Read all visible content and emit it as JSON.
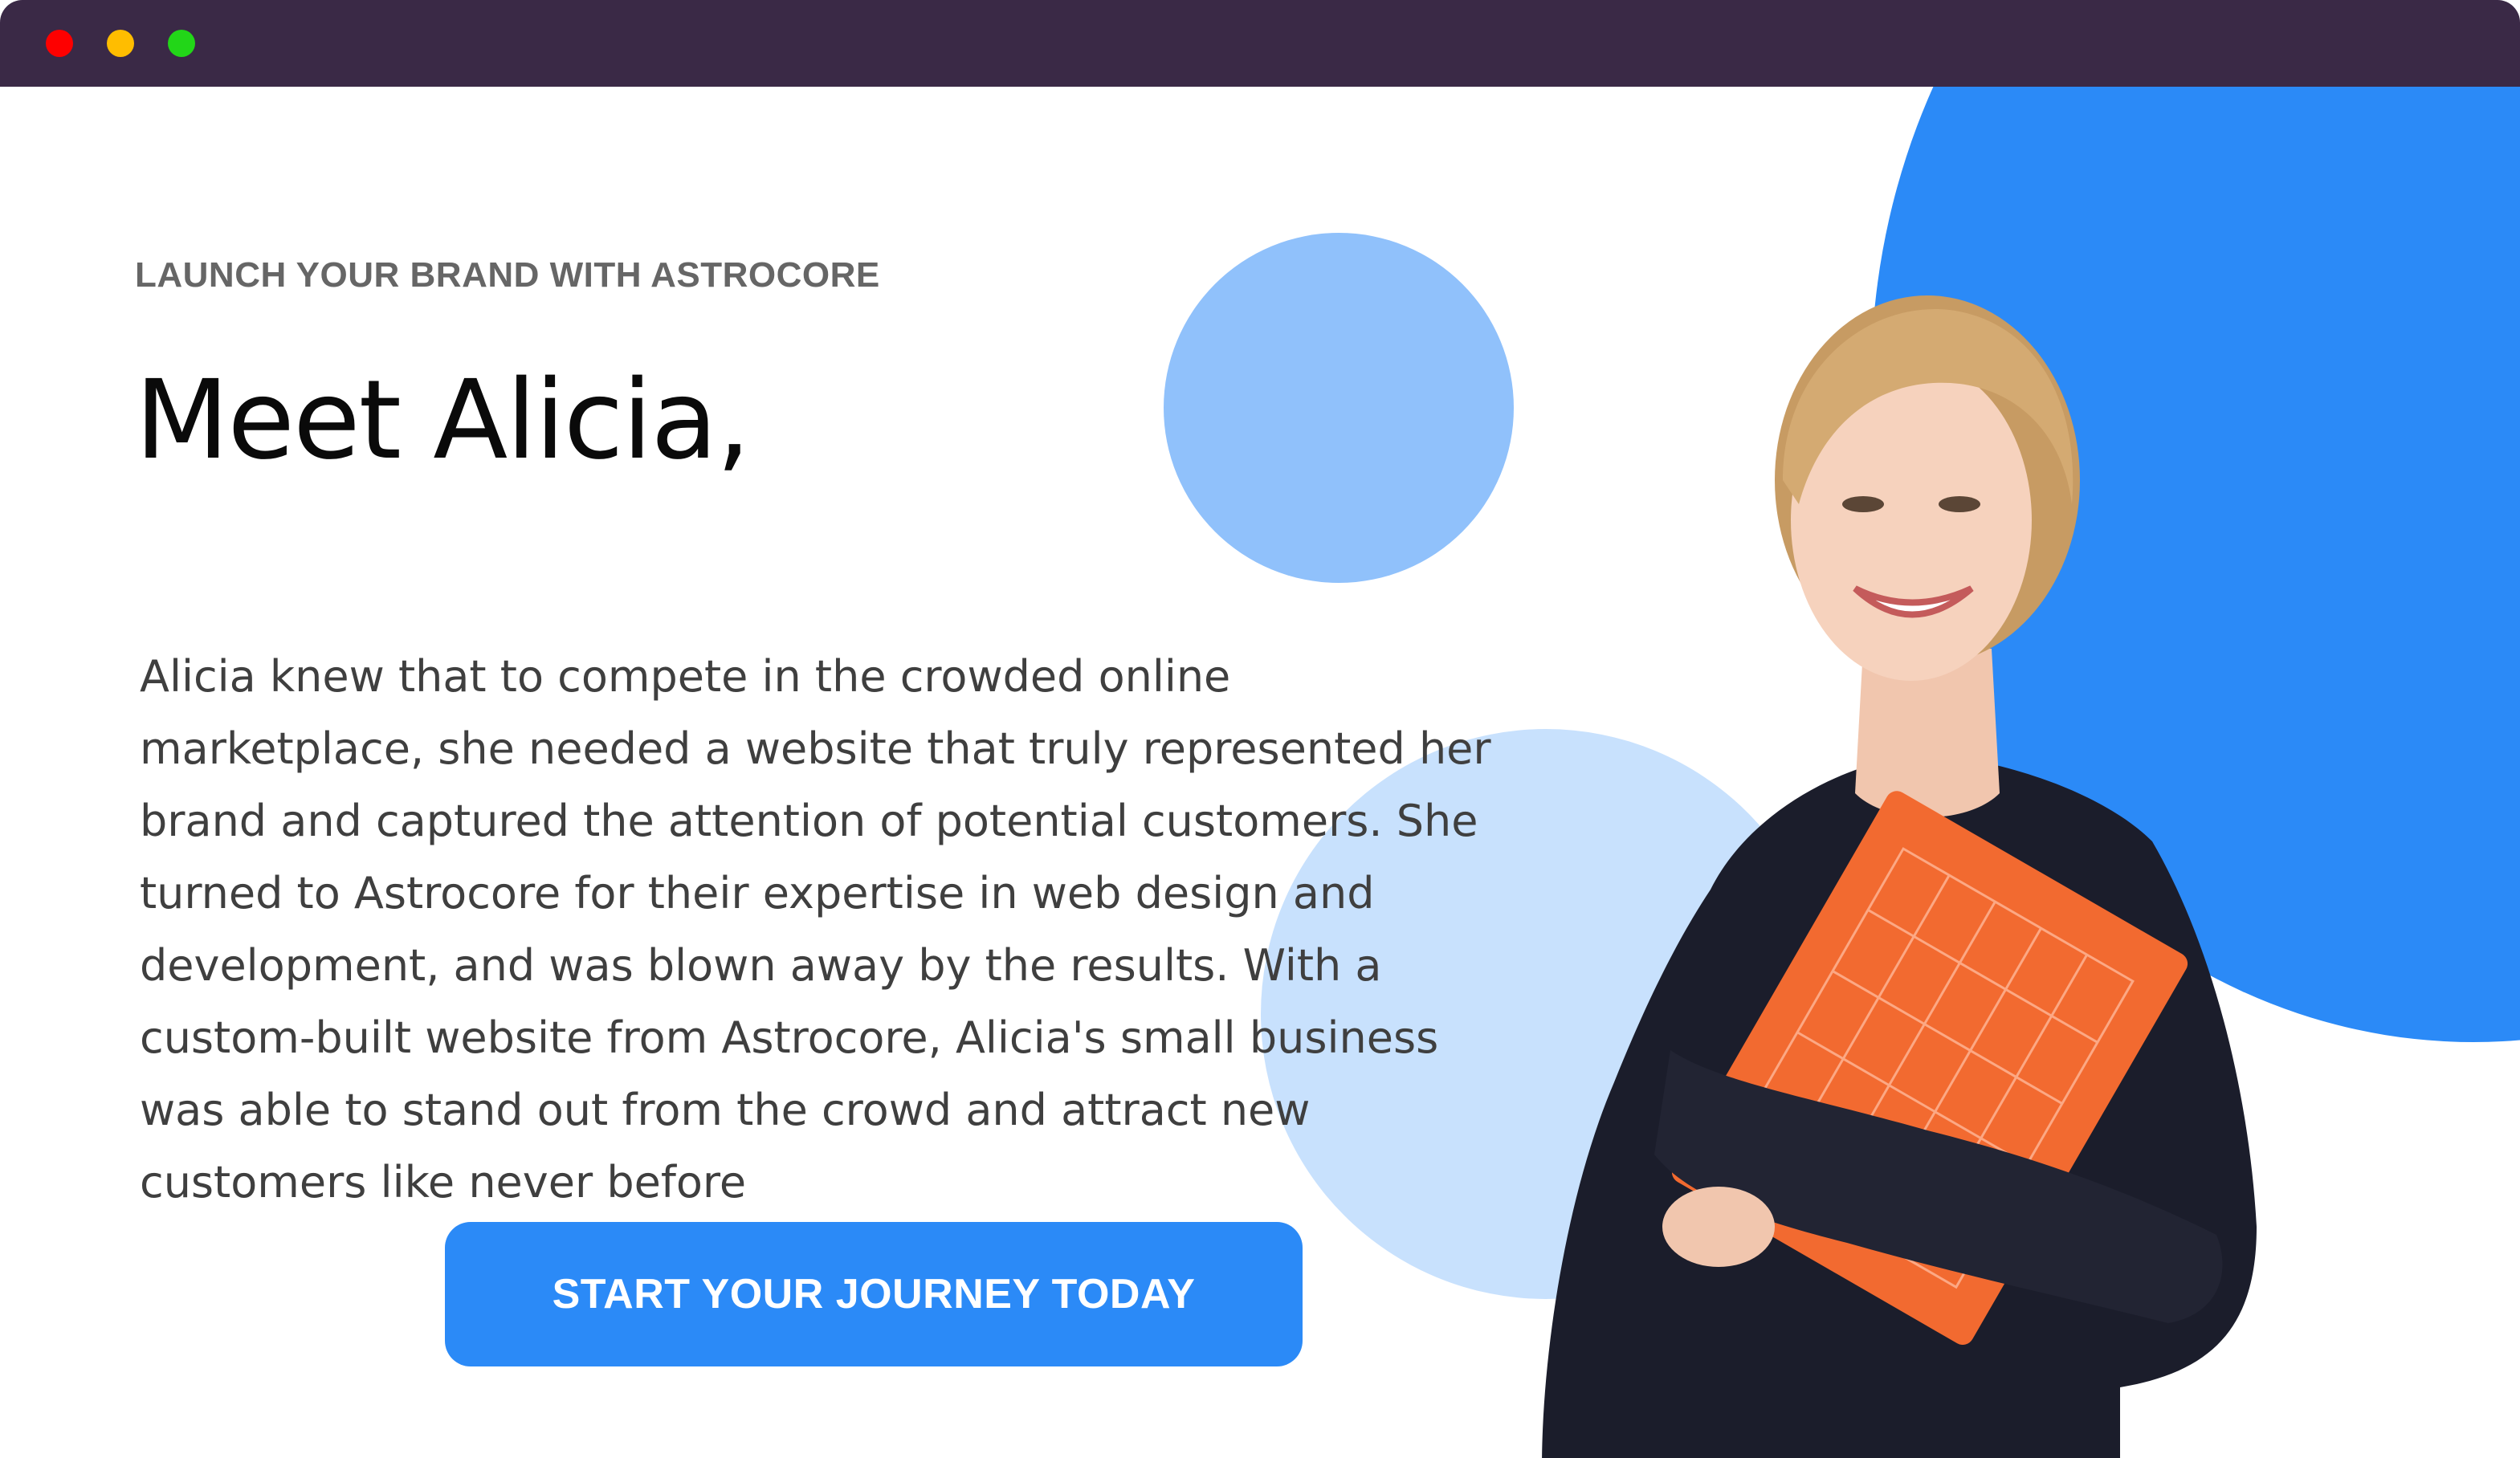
{
  "window": {
    "controls": [
      "close",
      "minimize",
      "maximize"
    ]
  },
  "hero": {
    "eyebrow": "LAUNCH YOUR BRAND WITH ASTROCORE",
    "headline": "Meet Alicia,",
    "body_lines": [
      "Alicia knew that to compete in the crowded online",
      "marketplace, she needed a website that truly represented her",
      "brand and captured the attention of potential customers. She",
      "turned to Astrocore for their expertise in web design and",
      "development, and was blown away by the results. With a",
      "custom-built website from Astrocore, Alicia's small business",
      "was able to stand out from the crowd and attract new",
      "customers like never before"
    ],
    "cta_label": "START YOUR JOURNEY TODAY"
  },
  "colors": {
    "titlebar": "#3a2946",
    "accent": "#2b8af7",
    "circle_mid": "#90c1fb",
    "circle_light": "#c8e1fd",
    "folder": "#f26a30",
    "sweater": "#1b1d2b"
  },
  "image": {
    "subject": "smiling woman holding orange folder"
  }
}
